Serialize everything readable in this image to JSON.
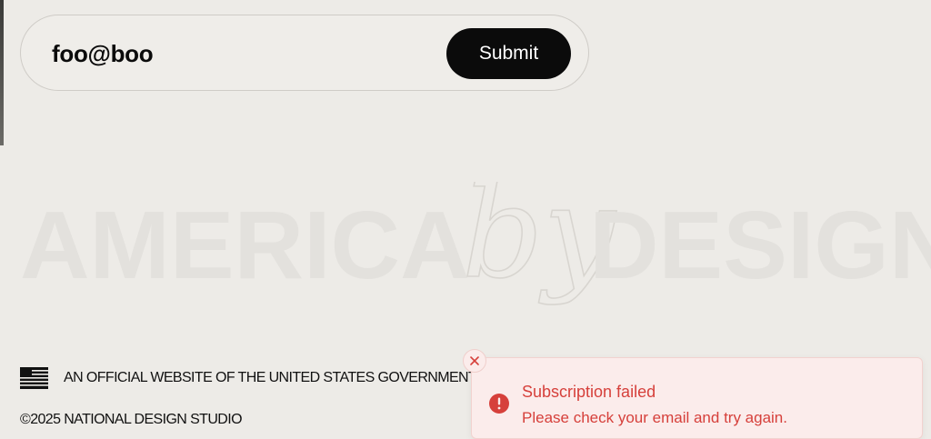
{
  "form": {
    "email_value": "foo@boo",
    "submit_label": "Submit"
  },
  "wordmark": {
    "left": "AMERICA",
    "script": "by",
    "right": "DESIGN"
  },
  "footer": {
    "government_notice": "AN OFFICIAL WEBSITE OF THE UNITED STATES GOVERNMENT",
    "copyright": "©2025 NATIONAL DESIGN STUDIO",
    "flag_icon": "us-flag-icon"
  },
  "toast": {
    "title": "Subscription failed",
    "message": "Please check your email and try again.",
    "icon": "alert-circle-icon",
    "close_icon": "close-icon",
    "accent_color": "#d6403b",
    "background_color": "#fbeceb"
  }
}
